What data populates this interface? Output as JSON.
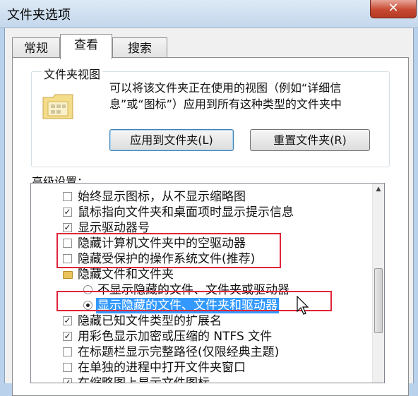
{
  "window": {
    "title": "文件夹选项",
    "close_label": "✕"
  },
  "tabs": [
    {
      "label": "常规"
    },
    {
      "label": "查看"
    },
    {
      "label": "搜索"
    }
  ],
  "folder_views": {
    "heading": "文件夹视图",
    "description_line1": "可以将该文件夹正在使用的视图（例如“详细信",
    "description_line2": "息”或“图标”）应用到所有这种类型的文件夹中",
    "apply_button": "应用到文件夹(L)",
    "reset_button": "重置文件夹(R)",
    "icon": "folder-view-icon"
  },
  "advanced": {
    "heading": "高级设置：",
    "items": [
      {
        "label": "始终显示图标，从不显示缩略图",
        "type": "checkbox",
        "checked": false
      },
      {
        "label": "鼠标指向文件夹和桌面项时显示提示信息",
        "type": "checkbox",
        "checked": true
      },
      {
        "label": "显示驱动器号",
        "type": "checkbox",
        "checked": true
      },
      {
        "label": "隐藏计算机文件夹中的空驱动器",
        "type": "checkbox",
        "checked": false
      },
      {
        "label": "隐藏受保护的操作系统文件(推荐)",
        "type": "checkbox",
        "checked": false
      },
      {
        "label": "隐藏文件和文件夹",
        "type": "folder"
      },
      {
        "label": "不显示隐藏的文件、文件夹或驱动器",
        "type": "radio",
        "checked": false
      },
      {
        "label": "显示隐藏的文件、文件夹和驱动器",
        "type": "radio",
        "checked": true,
        "selected": true
      },
      {
        "label": "隐藏已知文件类型的扩展名",
        "type": "checkbox",
        "checked": true
      },
      {
        "label": "用彩色显示加密或压缩的 NTFS 文件",
        "type": "checkbox",
        "checked": true
      },
      {
        "label": "在标题栏显示完整路径(仅限经典主题)",
        "type": "checkbox",
        "checked": false
      },
      {
        "label": "在单独的进程中打开文件夹窗口",
        "type": "checkbox",
        "checked": false
      },
      {
        "label": "在缩略图上显示文件图标",
        "type": "checkbox",
        "checked": true
      }
    ]
  },
  "colors": {
    "selection": "#3399ff",
    "highlight_box": "#e0263a"
  }
}
